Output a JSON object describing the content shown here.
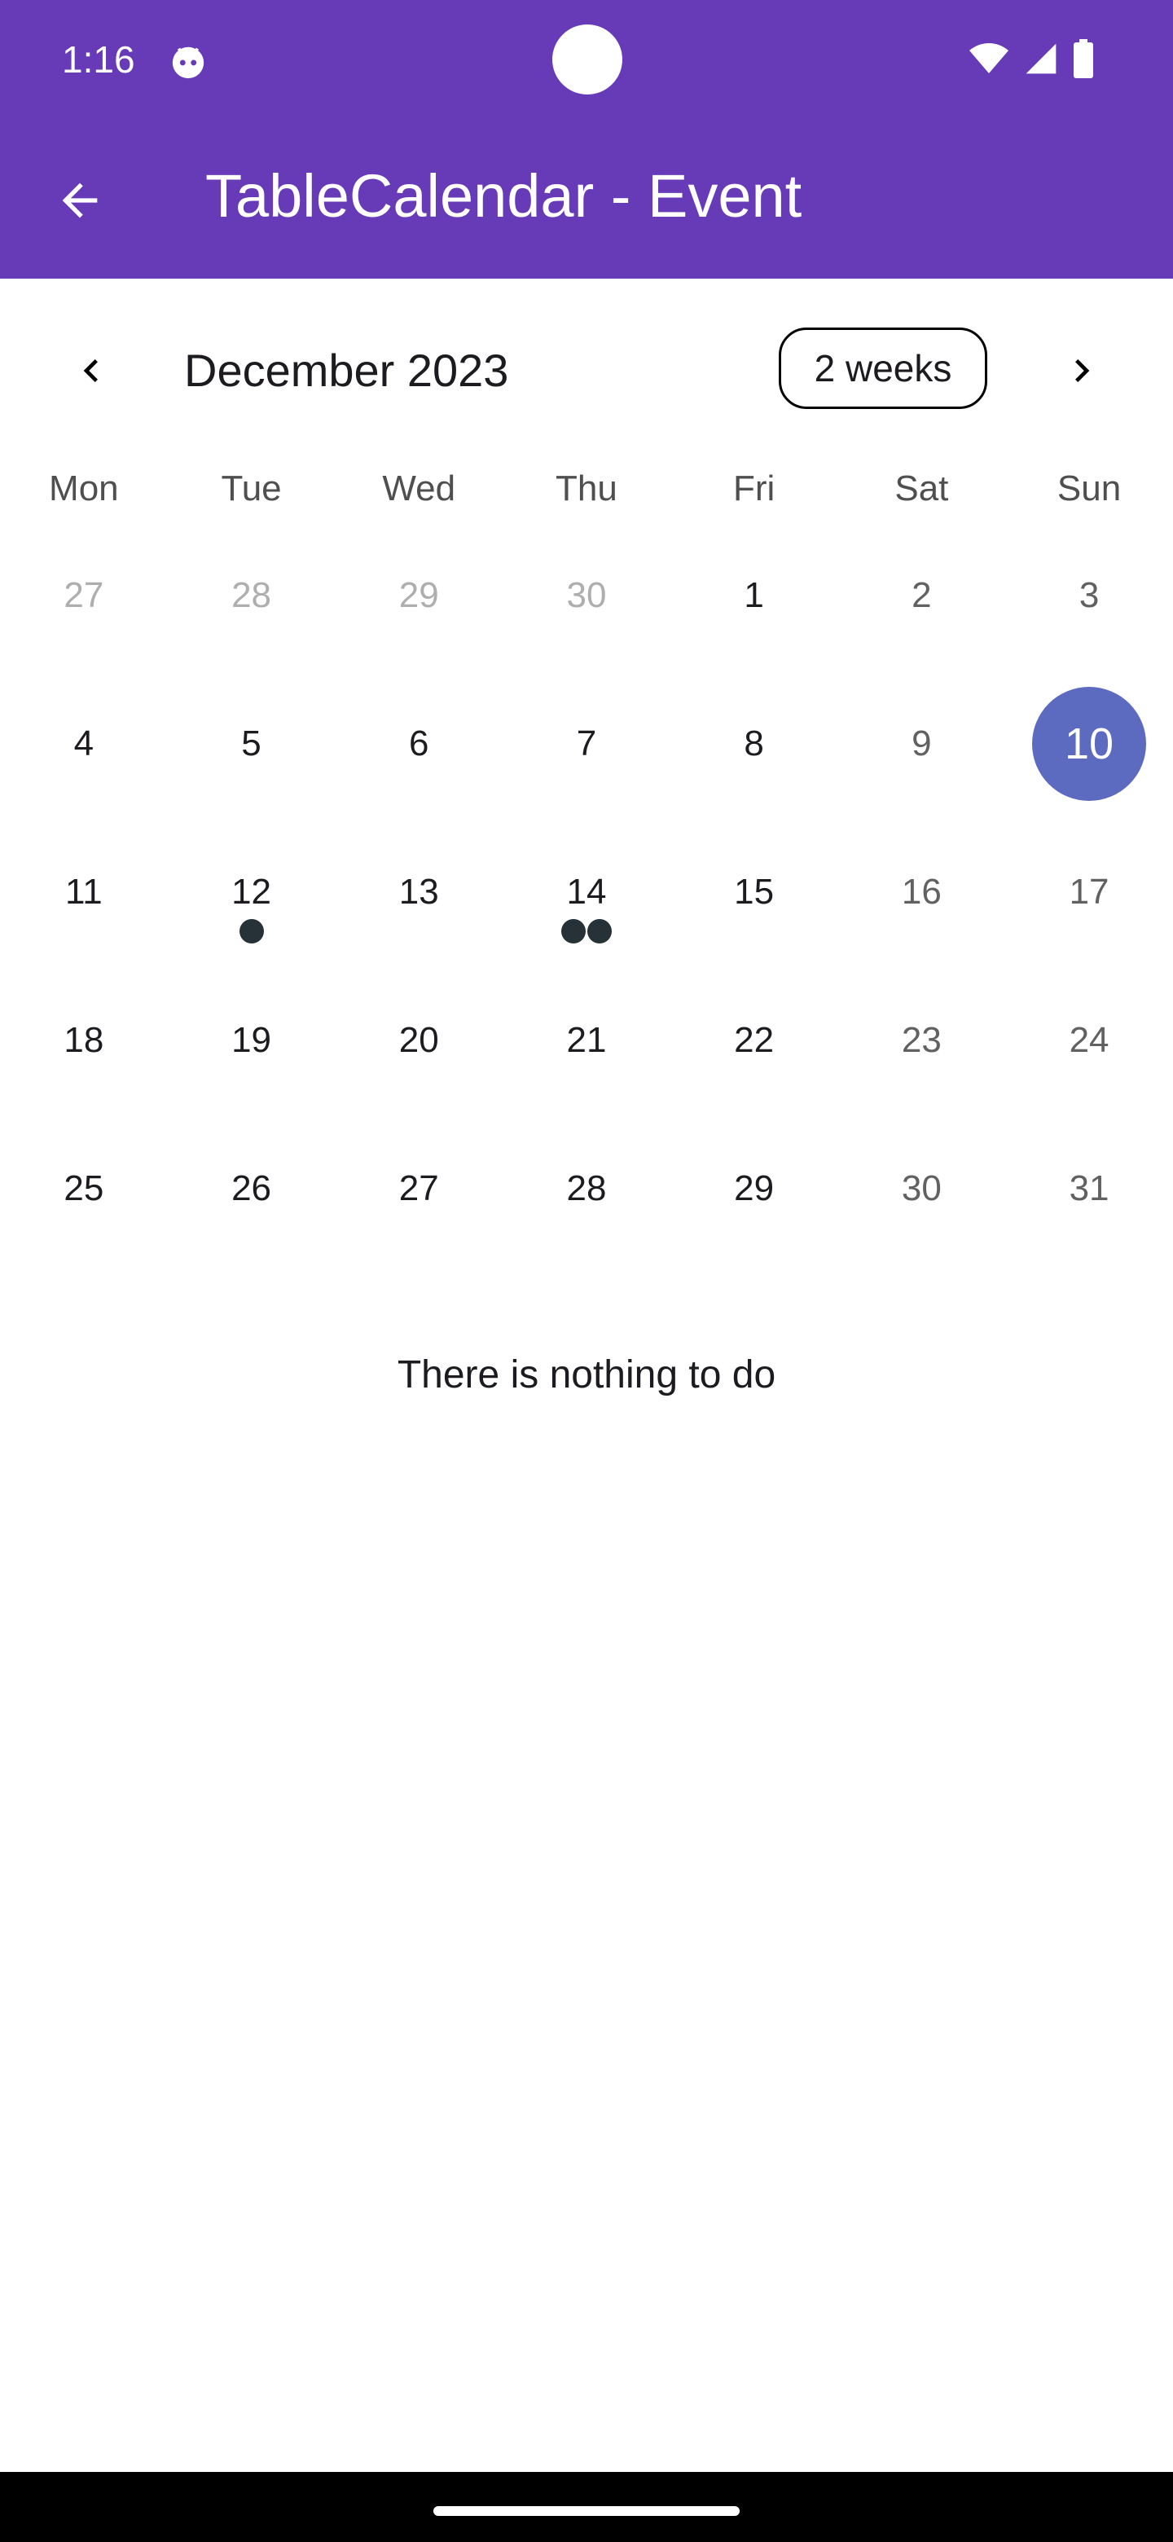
{
  "status_bar": {
    "time": "1:16",
    "icons": [
      "android-debug-icon",
      "wifi-icon",
      "cell-signal-icon",
      "battery-icon"
    ]
  },
  "app_bar": {
    "title": "TableCalendar - Event",
    "back_icon": "arrow-back-icon",
    "color": "#673AB7"
  },
  "calendar": {
    "month_title": "December 2023",
    "format_button": "2 weeks",
    "prev_icon": "chevron-left-icon",
    "next_icon": "chevron-right-icon",
    "days_of_week": [
      "Mon",
      "Tue",
      "Wed",
      "Thu",
      "Fri",
      "Sat",
      "Sun"
    ],
    "selected_color": "#5C6BC0",
    "weeks": [
      [
        {
          "day": "27",
          "outside": true
        },
        {
          "day": "28",
          "outside": true
        },
        {
          "day": "29",
          "outside": true
        },
        {
          "day": "30",
          "outside": true
        },
        {
          "day": "1"
        },
        {
          "day": "2",
          "weekend": true
        },
        {
          "day": "3",
          "weekend": true
        }
      ],
      [
        {
          "day": "4"
        },
        {
          "day": "5"
        },
        {
          "day": "6"
        },
        {
          "day": "7"
        },
        {
          "day": "8"
        },
        {
          "day": "9",
          "weekend": true
        },
        {
          "day": "10",
          "selected": true
        }
      ],
      [
        {
          "day": "11"
        },
        {
          "day": "12",
          "events": 1
        },
        {
          "day": "13"
        },
        {
          "day": "14",
          "events": 2
        },
        {
          "day": "15"
        },
        {
          "day": "16",
          "weekend": true
        },
        {
          "day": "17",
          "weekend": true
        }
      ],
      [
        {
          "day": "18"
        },
        {
          "day": "19"
        },
        {
          "day": "20"
        },
        {
          "day": "21"
        },
        {
          "day": "22"
        },
        {
          "day": "23",
          "weekend": true
        },
        {
          "day": "24",
          "weekend": true
        }
      ],
      [
        {
          "day": "25"
        },
        {
          "day": "26"
        },
        {
          "day": "27"
        },
        {
          "day": "28"
        },
        {
          "day": "29"
        },
        {
          "day": "30",
          "weekend": true
        },
        {
          "day": "31",
          "weekend": true
        }
      ]
    ]
  },
  "events_panel": {
    "empty_message": "There is nothing to do"
  }
}
